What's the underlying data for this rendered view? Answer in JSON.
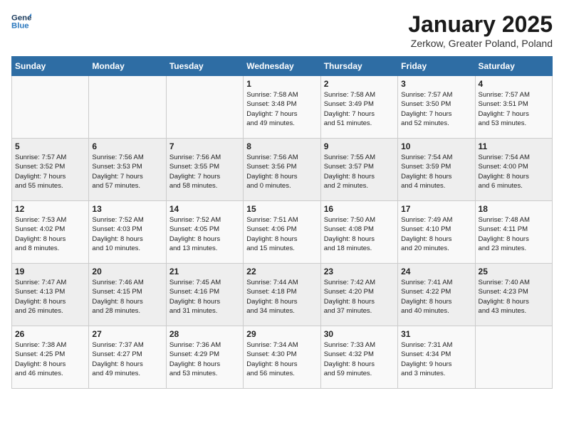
{
  "logo": {
    "line1": "General",
    "line2": "Blue"
  },
  "title": "January 2025",
  "subtitle": "Zerkow, Greater Poland, Poland",
  "days_of_week": [
    "Sunday",
    "Monday",
    "Tuesday",
    "Wednesday",
    "Thursday",
    "Friday",
    "Saturday"
  ],
  "weeks": [
    [
      {
        "num": "",
        "info": ""
      },
      {
        "num": "",
        "info": ""
      },
      {
        "num": "",
        "info": ""
      },
      {
        "num": "1",
        "info": "Sunrise: 7:58 AM\nSunset: 3:48 PM\nDaylight: 7 hours\nand 49 minutes."
      },
      {
        "num": "2",
        "info": "Sunrise: 7:58 AM\nSunset: 3:49 PM\nDaylight: 7 hours\nand 51 minutes."
      },
      {
        "num": "3",
        "info": "Sunrise: 7:57 AM\nSunset: 3:50 PM\nDaylight: 7 hours\nand 52 minutes."
      },
      {
        "num": "4",
        "info": "Sunrise: 7:57 AM\nSunset: 3:51 PM\nDaylight: 7 hours\nand 53 minutes."
      }
    ],
    [
      {
        "num": "5",
        "info": "Sunrise: 7:57 AM\nSunset: 3:52 PM\nDaylight: 7 hours\nand 55 minutes."
      },
      {
        "num": "6",
        "info": "Sunrise: 7:56 AM\nSunset: 3:53 PM\nDaylight: 7 hours\nand 57 minutes."
      },
      {
        "num": "7",
        "info": "Sunrise: 7:56 AM\nSunset: 3:55 PM\nDaylight: 7 hours\nand 58 minutes."
      },
      {
        "num": "8",
        "info": "Sunrise: 7:56 AM\nSunset: 3:56 PM\nDaylight: 8 hours\nand 0 minutes."
      },
      {
        "num": "9",
        "info": "Sunrise: 7:55 AM\nSunset: 3:57 PM\nDaylight: 8 hours\nand 2 minutes."
      },
      {
        "num": "10",
        "info": "Sunrise: 7:54 AM\nSunset: 3:59 PM\nDaylight: 8 hours\nand 4 minutes."
      },
      {
        "num": "11",
        "info": "Sunrise: 7:54 AM\nSunset: 4:00 PM\nDaylight: 8 hours\nand 6 minutes."
      }
    ],
    [
      {
        "num": "12",
        "info": "Sunrise: 7:53 AM\nSunset: 4:02 PM\nDaylight: 8 hours\nand 8 minutes."
      },
      {
        "num": "13",
        "info": "Sunrise: 7:52 AM\nSunset: 4:03 PM\nDaylight: 8 hours\nand 10 minutes."
      },
      {
        "num": "14",
        "info": "Sunrise: 7:52 AM\nSunset: 4:05 PM\nDaylight: 8 hours\nand 13 minutes."
      },
      {
        "num": "15",
        "info": "Sunrise: 7:51 AM\nSunset: 4:06 PM\nDaylight: 8 hours\nand 15 minutes."
      },
      {
        "num": "16",
        "info": "Sunrise: 7:50 AM\nSunset: 4:08 PM\nDaylight: 8 hours\nand 18 minutes."
      },
      {
        "num": "17",
        "info": "Sunrise: 7:49 AM\nSunset: 4:10 PM\nDaylight: 8 hours\nand 20 minutes."
      },
      {
        "num": "18",
        "info": "Sunrise: 7:48 AM\nSunset: 4:11 PM\nDaylight: 8 hours\nand 23 minutes."
      }
    ],
    [
      {
        "num": "19",
        "info": "Sunrise: 7:47 AM\nSunset: 4:13 PM\nDaylight: 8 hours\nand 26 minutes."
      },
      {
        "num": "20",
        "info": "Sunrise: 7:46 AM\nSunset: 4:15 PM\nDaylight: 8 hours\nand 28 minutes."
      },
      {
        "num": "21",
        "info": "Sunrise: 7:45 AM\nSunset: 4:16 PM\nDaylight: 8 hours\nand 31 minutes."
      },
      {
        "num": "22",
        "info": "Sunrise: 7:44 AM\nSunset: 4:18 PM\nDaylight: 8 hours\nand 34 minutes."
      },
      {
        "num": "23",
        "info": "Sunrise: 7:42 AM\nSunset: 4:20 PM\nDaylight: 8 hours\nand 37 minutes."
      },
      {
        "num": "24",
        "info": "Sunrise: 7:41 AM\nSunset: 4:22 PM\nDaylight: 8 hours\nand 40 minutes."
      },
      {
        "num": "25",
        "info": "Sunrise: 7:40 AM\nSunset: 4:23 PM\nDaylight: 8 hours\nand 43 minutes."
      }
    ],
    [
      {
        "num": "26",
        "info": "Sunrise: 7:38 AM\nSunset: 4:25 PM\nDaylight: 8 hours\nand 46 minutes."
      },
      {
        "num": "27",
        "info": "Sunrise: 7:37 AM\nSunset: 4:27 PM\nDaylight: 8 hours\nand 49 minutes."
      },
      {
        "num": "28",
        "info": "Sunrise: 7:36 AM\nSunset: 4:29 PM\nDaylight: 8 hours\nand 53 minutes."
      },
      {
        "num": "29",
        "info": "Sunrise: 7:34 AM\nSunset: 4:30 PM\nDaylight: 8 hours\nand 56 minutes."
      },
      {
        "num": "30",
        "info": "Sunrise: 7:33 AM\nSunset: 4:32 PM\nDaylight: 8 hours\nand 59 minutes."
      },
      {
        "num": "31",
        "info": "Sunrise: 7:31 AM\nSunset: 4:34 PM\nDaylight: 9 hours\nand 3 minutes."
      },
      {
        "num": "",
        "info": ""
      }
    ]
  ]
}
